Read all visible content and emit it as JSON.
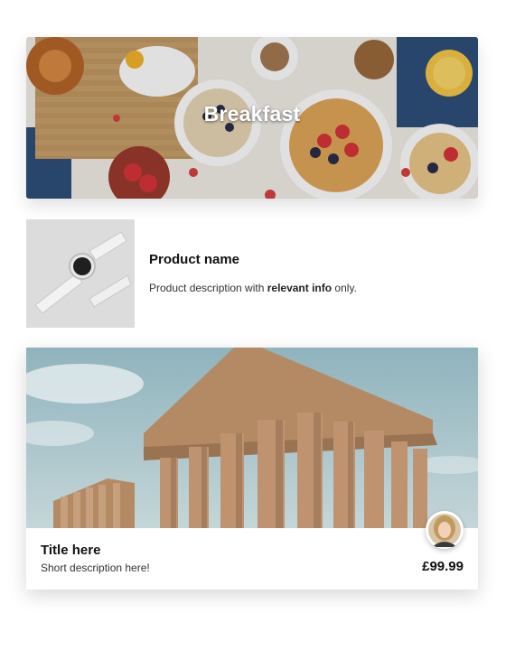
{
  "hero_card": {
    "title": "Breakfast"
  },
  "product": {
    "name": "Product name",
    "description_prefix": "Product description with ",
    "description_bold": "relevant info",
    "description_suffix": " only."
  },
  "photo_card": {
    "title": "Title here",
    "subtitle": "Short description here!",
    "price": "£99.99"
  },
  "icons": {
    "product_image": "smartwatch-image",
    "avatar": "user-avatar-image"
  }
}
